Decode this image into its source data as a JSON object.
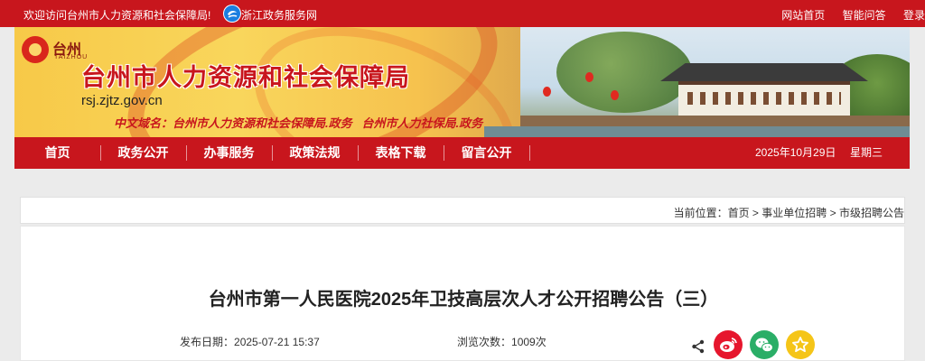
{
  "topbar": {
    "welcome": "欢迎访问台州市人力资源和社会保障局!",
    "zj_link": "浙江政务服务网",
    "links": [
      "网站首页",
      "智能问答",
      "登录"
    ]
  },
  "banner": {
    "logo_city": "台州",
    "logo_en": "TAIZHOU",
    "site_title": "台州市人力资源和社会保障局",
    "domain": "rsj.zjtz.gov.cn",
    "cn_name_label": "中文域名：",
    "cn_name_value": "台州市人力资源和社会保障局.政务   台州市人力社保局.政务"
  },
  "nav": {
    "items": [
      "首页",
      "政务公开",
      "办事服务",
      "政策法规",
      "表格下载",
      "留言公开"
    ],
    "date": "2025年10月29日",
    "weekday": "星期三"
  },
  "breadcrumb": {
    "label": "当前位置：",
    "items": [
      "首页",
      "事业单位招聘",
      "市级招聘公告"
    ],
    "separator": " > "
  },
  "article": {
    "title": "台州市第一人民医院2025年卫技高层次人才公开招聘公告（三）",
    "publish_label": "发布日期：",
    "publish_date": "2025-07-21 15:37",
    "views_label": "浏览次数：",
    "views_value": "1009次"
  },
  "share": {
    "icons": [
      "share-icon",
      "weibo-icon",
      "wechat-icon",
      "favorite-star-icon"
    ]
  },
  "colors": {
    "brand_red": "#c8161d",
    "weibo_red": "#e6162d",
    "wechat_green": "#2aae67",
    "star_yellow": "#f5c518"
  }
}
